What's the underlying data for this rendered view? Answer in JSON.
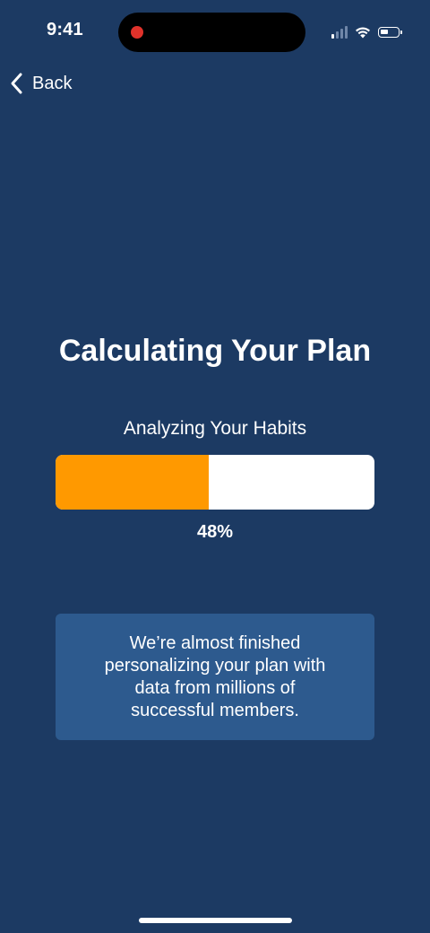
{
  "status_bar": {
    "time": "9:41",
    "icons": [
      "signal-icon",
      "wifi-icon",
      "battery-icon"
    ],
    "recording_color": "#E0322B"
  },
  "nav": {
    "back_label": "Back",
    "back_icon": "chevron-left-icon"
  },
  "main": {
    "title": "Calculating Your Plan",
    "progress": {
      "label": "Analyzing Your Habits",
      "percent_text": "48%",
      "value": 0.48
    },
    "info_card": {
      "text": "We’re almost finished personalizing your plan with data from millions of successful members."
    }
  },
  "colors": {
    "background": "#1C3A63",
    "accent": "#FF9900",
    "card": "#2D5A8E"
  }
}
